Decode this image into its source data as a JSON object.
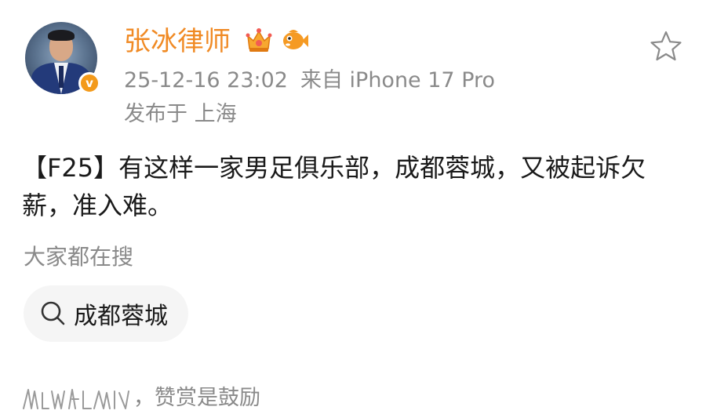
{
  "author": {
    "name": "张冰律师",
    "verified_mark": "v"
  },
  "meta": {
    "datetime": "25-12-16 23:02",
    "source": "来自 iPhone 17 Pro",
    "location": "发布于 上海"
  },
  "post": {
    "text": "【F25】有这样一家男足俱乐部，成都蓉城，又被起诉欠薪，准入难。"
  },
  "search": {
    "label": "大家都在搜",
    "chip": "成都蓉城"
  },
  "reward": {
    "text": "，赞赏是鼓励"
  },
  "icons": {
    "crown": "crown-badge-icon",
    "fish": "fish-badge-icon",
    "star": "star-icon",
    "search": "search-icon"
  },
  "colors": {
    "name": "#f08a24",
    "meta": "#8a8a8a",
    "badge": "#f39a1b",
    "chip_bg": "#f5f5f5"
  }
}
